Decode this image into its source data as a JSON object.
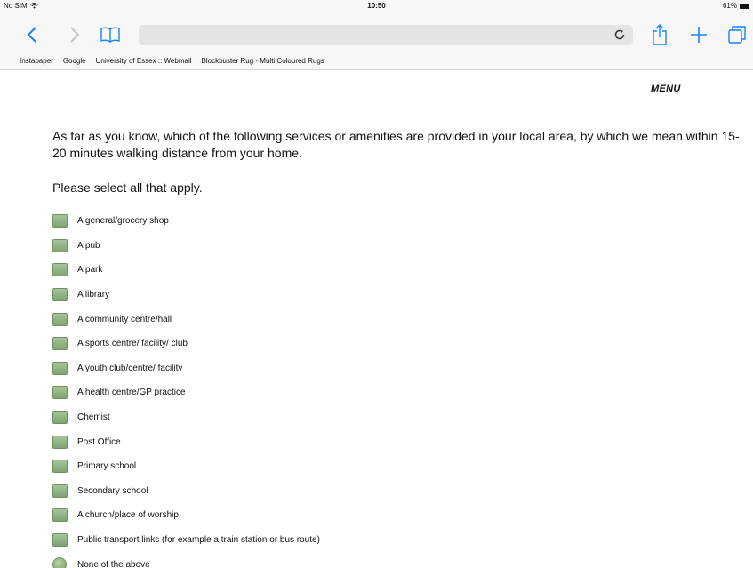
{
  "status_bar": {
    "carrier": "No SIM",
    "time": "10:50",
    "battery": "61%"
  },
  "toolbar": {
    "icons": [
      "back-icon",
      "forward-icon",
      "bookmarks-icon",
      "reload-icon",
      "share-icon",
      "add-icon",
      "tabs-icon"
    ]
  },
  "bookmarks": [
    {
      "label": "Instapaper"
    },
    {
      "label": "Google"
    },
    {
      "label": "University of Essex :: Webmail"
    },
    {
      "label": "Blockbuster Rug - Multi Coloured Rugs"
    }
  ],
  "page": {
    "menu_label": "MENU",
    "question": "As far as you know, which of the following services or amenities are provided in your local area, by which we mean within 15-20 minutes walking distance from your home.",
    "instruction": "Please select all that apply.",
    "options": [
      {
        "label": "A general/grocery shop"
      },
      {
        "label": "A pub"
      },
      {
        "label": "A park"
      },
      {
        "label": "A library"
      },
      {
        "label": "A community centre/hall"
      },
      {
        "label": "A sports centre/ facility/ club"
      },
      {
        "label": "A youth club/centre/ facility"
      },
      {
        "label": "A health centre/GP practice"
      },
      {
        "label": "Chemist"
      },
      {
        "label": "Post Office"
      },
      {
        "label": "Primary school"
      },
      {
        "label": "Secondary school"
      },
      {
        "label": "A church/place of worship"
      },
      {
        "label": "Public transport links (for example a train station or bus route)"
      }
    ],
    "none_option": "None of the above"
  },
  "colors": {
    "checkbox_fill": "#8fb27f",
    "ios_blue": "#1a82fb",
    "chrome_bg": "#f7f7f7"
  }
}
